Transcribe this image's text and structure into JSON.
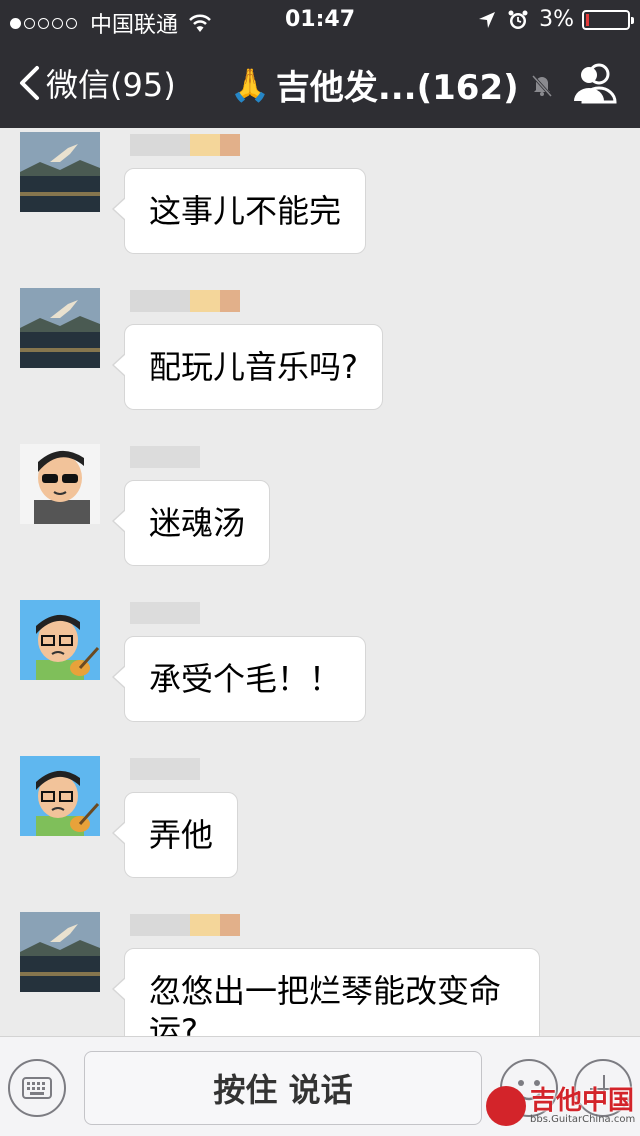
{
  "status_bar": {
    "carrier": "中国联通",
    "time": "01:47",
    "battery_text": "3%",
    "battery_level": 0.03
  },
  "nav": {
    "back_label": "微信(95)",
    "title": "吉他发...(162)",
    "title_emoji": "🙏",
    "muted": true
  },
  "messages": [
    {
      "sender": "nick-blurred-1",
      "avatar": "lake-photo",
      "text": "这事儿不能完"
    },
    {
      "sender": "nick-blurred-1",
      "avatar": "lake-photo",
      "text": "配玩儿音乐吗?"
    },
    {
      "sender": "nick-blurred-2",
      "avatar": "cartoon-sunglasses",
      "text": "迷魂汤"
    },
    {
      "sender": "nick-blurred-3",
      "avatar": "cartoon-guitarist",
      "text": "承受个毛！！"
    },
    {
      "sender": "nick-blurred-3",
      "avatar": "cartoon-guitarist",
      "text": "弄他"
    },
    {
      "sender": "nick-blurred-1",
      "avatar": "lake-photo",
      "text": "忽悠出一把烂琴能改变命运?"
    }
  ],
  "input_bar": {
    "hold_to_talk": "按住 说话"
  },
  "watermark": {
    "text": "吉他中国",
    "site": "bbs.GuitarChina.com"
  },
  "colors": {
    "nav_bg": "#2e2e33",
    "chat_bg": "#ebebeb",
    "bubble_bg": "#ffffff",
    "avatar_blue": "#5fb7ef",
    "watermark_red": "#d3242a"
  }
}
